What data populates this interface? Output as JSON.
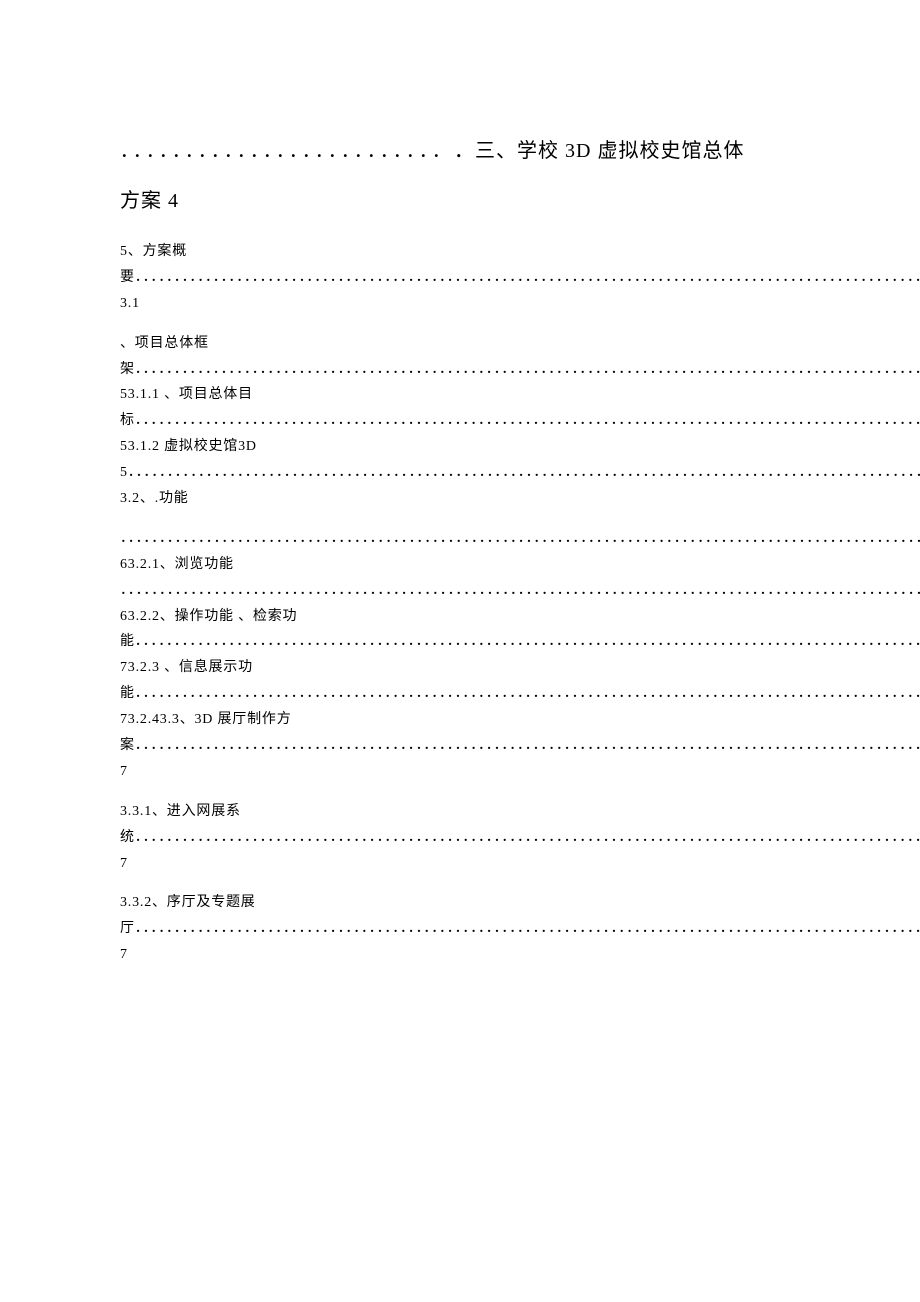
{
  "title": {
    "dots": "．．．．．．．．．．．．．．．．．．．．．．．．．",
    "text1": "．三、学校 3D 虚拟校史馆总体",
    "text2": "方案 4"
  },
  "entries": [
    "5、方案概要．．．．．．．．．．．．．．．．．．．．．．．．．．．．．．．．．．．．．．．．．．．．．．．．．．．．．．．．．．．．．．．．．．．．．．．．．．．．．．．．．．．．．．．．．．．．．．．．．．．．．．．．．．．．．．．．．．．．．．．．．．．．．．．．．．．．．．．．．．．．．．． 3.1",
    "、项目总体框架．．．．．．．．．．．．．．．．．．．．．．．．．．．．．．．．．．．．．．．．．．．．．．．．．．．．．．．．．．．．．．．．．．．．．．．．．．．．．．．．．．．．．．．．．．．．．．．．．．．．．．．．．．．．．．．．．．．．．．．．．．．．．．．．．．．．．．．．．．53.1.1 、项目总体目标．．．．．．．．．．．．．．．．．．．．．．．．．．．．．．．．．．．．．．．．．．．．．．．．．．．．．．．．．．．．．．．．．．．．．．．．．．．．．．．．．．．．．．．．．．．．．．．．．．．．．．．．．．．．．．．．．．．．．．．．．．．．．．．．．．．．．．．．．．53.1.2 虚拟校史馆3D5．．．．．．．．．．．．．．．．．．．．．．．．．．．．．．．．．．．．．．．．．．．．．．．．．．．．．．．．．．．．．．．．．．．．．．．．．．．．．．．．．．．．．．．．．．．．．．．．．．．．．．．．．．．．．．．．．．．．．．．．．．．．．．．．   3.2、.功能",
    "  ．．．．．．．．．．．．．．．．．．．．．．．．．．．．．．．．．．．．．．．．．．．．．．．．．．．．．．．．．．．．．．．．．．．．．．．．．．．．．．．．．．．．．．．．．．．．．．．．．．．．．．．．．．．．．．．．．．．．．．．．．．．．．．．．．．．．．．．．．．．．．．．．．．．． 63.2.1、浏览功能   ．．．．．．．．．．．．．．．．．．．．．．．．．．．．．．．．．．．．．．．．．．．．．．．．．．．．．．．．．．．．．．．．．．．．．．．．．．．．．．．．．．．．．．．．．．．．．．．．．．．．．．．．．．．．．．．．．．．．．．．．．．．．．．．．．．．．．．．．．．．．．．．．．．．．．． 63.2.2、操作功能 、检索功能．．．．．．．．．．．．．．．．．．．．．．．．．．．．．．．．．．．．．．．．．．．．．．．．．．．．．．．．．．．．．．．．．．．．．．．．．．．．．．．．．．．．．．．．．．．．．．．．．．．．．．．．．．．．．．．．．．．．．．．．．．．．．．．．．．．．．．．．．．．．．．．．．．．．． 73.2.3 、信息展示功能．．．．．．．．．．．．．．．．．．．．．．．．．．．．．．．．．．．．．．．．．．．．．．．．．．．．．．．．．．．．．．．．．．．．．．．．．．．．．．．．．．．．．．．．．．．．．．．．．．．．．．．．．．．．．．．．．．．．．．．．．．．．．．．．．．．．．．．．．．73.2.43.3、3D 展厅制作方案．．．．．．．．．．．．．．．．．．．．．．．．．．．．．．．．．．．．．．．．．．．．．．．．．．．．．．．．．．．．．．．．．．．．．．．．．．．．．．．．．．．．．．．．．．．．．．．．．．．．．．．．．．．．．．．．．．．．．．．．．．．．．．．．．．．．．．．．． 7",
    "3.3.1、进入网展系统．．．．．．．．．．．．．．．．．．．．．．．．．．．．．．．．．．．．．．．．．．．．．．．．．．．．．．．．．．．．．．．．．．．．．．．．．．．．．．．．．．．．．．．．．．．．．．．．．．．．．．．．．．．．．．．．．．．．．．．．．．．．．．．．．．．．．．．．．．7",
    "3.3.2、序厅及专题展厅．．．．．．．．．．．．．．．．．．．．．．．．．．．．．．．．．．．．．．．．．．．．．．．．．．．．．．．．．．．．．．．．．．．．．．．．．．．．．．．．．．．．．．．．．．．．．．．．．．．．．．．．．．．．．．．．．．．．．．．．．．．．．．．．．．．．．．．．． 7"
  ]
}
